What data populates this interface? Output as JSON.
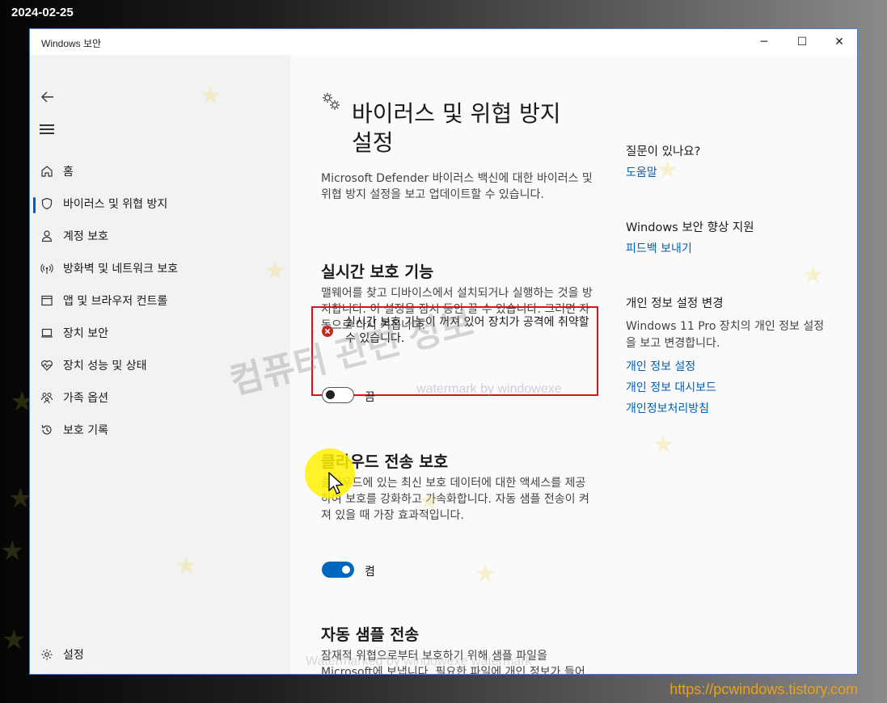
{
  "overlay": {
    "date": "2024-02-25",
    "site_url": "https://pcwindows.tistory.com",
    "watermark_text": "컴퓨터 관련 정보",
    "watermark_sub": "watermark by windowexe",
    "watermark_bottom": "Watermarked by windowexe watermark"
  },
  "window": {
    "title": "Windows 보안",
    "buttons": {
      "minimize": "─",
      "maximize": "☐",
      "close": "✕"
    }
  },
  "sidebar": {
    "items": [
      {
        "label": "홈",
        "icon": "home-icon"
      },
      {
        "label": "바이러스 및 위협 방지",
        "icon": "shield-icon"
      },
      {
        "label": "계정 보호",
        "icon": "person-icon"
      },
      {
        "label": "방화벽 및 네트워크 보호",
        "icon": "wifi-signal-icon"
      },
      {
        "label": "앱 및 브라우저 컨트롤",
        "icon": "app-window-icon"
      },
      {
        "label": "장치 보안",
        "icon": "laptop-icon"
      },
      {
        "label": "장치 성능 및 상태",
        "icon": "heart-pulse-icon"
      },
      {
        "label": "가족 옵션",
        "icon": "family-icon"
      },
      {
        "label": "보호 기록",
        "icon": "history-icon"
      }
    ],
    "settings_label": "설정"
  },
  "main": {
    "title": "바이러스 및 위협 방지 설정",
    "title_line1": "바이러스 및 위협 방지",
    "title_line2": "설정",
    "description": "Microsoft Defender 바이러스 백신에 대한 바이러스 및 위협 방지 설정을 보고 업데이트할 수 있습니다.",
    "realtime": {
      "title": "실시간 보호 기능",
      "description": "맬웨어를 찾고 디바이스에서 설치되거나 실행하는 것을 방지합니다. 이 설정을 잠시 동안 끌 수 있습니다. 그러면 자동으로 다시 켜집니다.",
      "warning": "실시간 보호 기능이 꺼져 있어 장치가 공격에 취약할 수 있습니다.",
      "toggle_label": "끔",
      "enabled": false
    },
    "cloud": {
      "title": "클라우드 전송 보호",
      "description": "클라우드에 있는 최신 보호 데이터에 대한 액세스를 제공하여 보호를 강화하고 가속화합니다. 자동 샘플 전송이 켜져 있을 때 가장 효과적입니다.",
      "toggle_label": "켬",
      "enabled": true
    },
    "auto_sample": {
      "title": "자동 샘플 전송",
      "description": "잠재적 위협으로부터 보호하기 위해 샘플 파일을 Microsoft에 보냅니다. 필요한 파일에 개인 정보가 들어 있을 가능성이 있는지 확인하는 메시지가 표시됩니다."
    }
  },
  "right_column": {
    "question_head": "질문이 있나요?",
    "help_link": "도움말",
    "improve_head": "Windows 보안 향상 지원",
    "feedback_link": "피드백 보내기",
    "privacy_head": "개인 정보 설정 변경",
    "privacy_text": "Windows 11 Pro 장치의 개인 정보 설정을 보고 변경합니다.",
    "links": [
      "개인 정보 설정",
      "개인 정보 대시보드",
      "개인정보처리방침"
    ]
  },
  "colors": {
    "accent": "#005fb8",
    "toggle_on": "#0067c0",
    "warning_red": "#d6141c",
    "highlight_box": "#d6141c",
    "cursor_highlight": "#fff000"
  }
}
